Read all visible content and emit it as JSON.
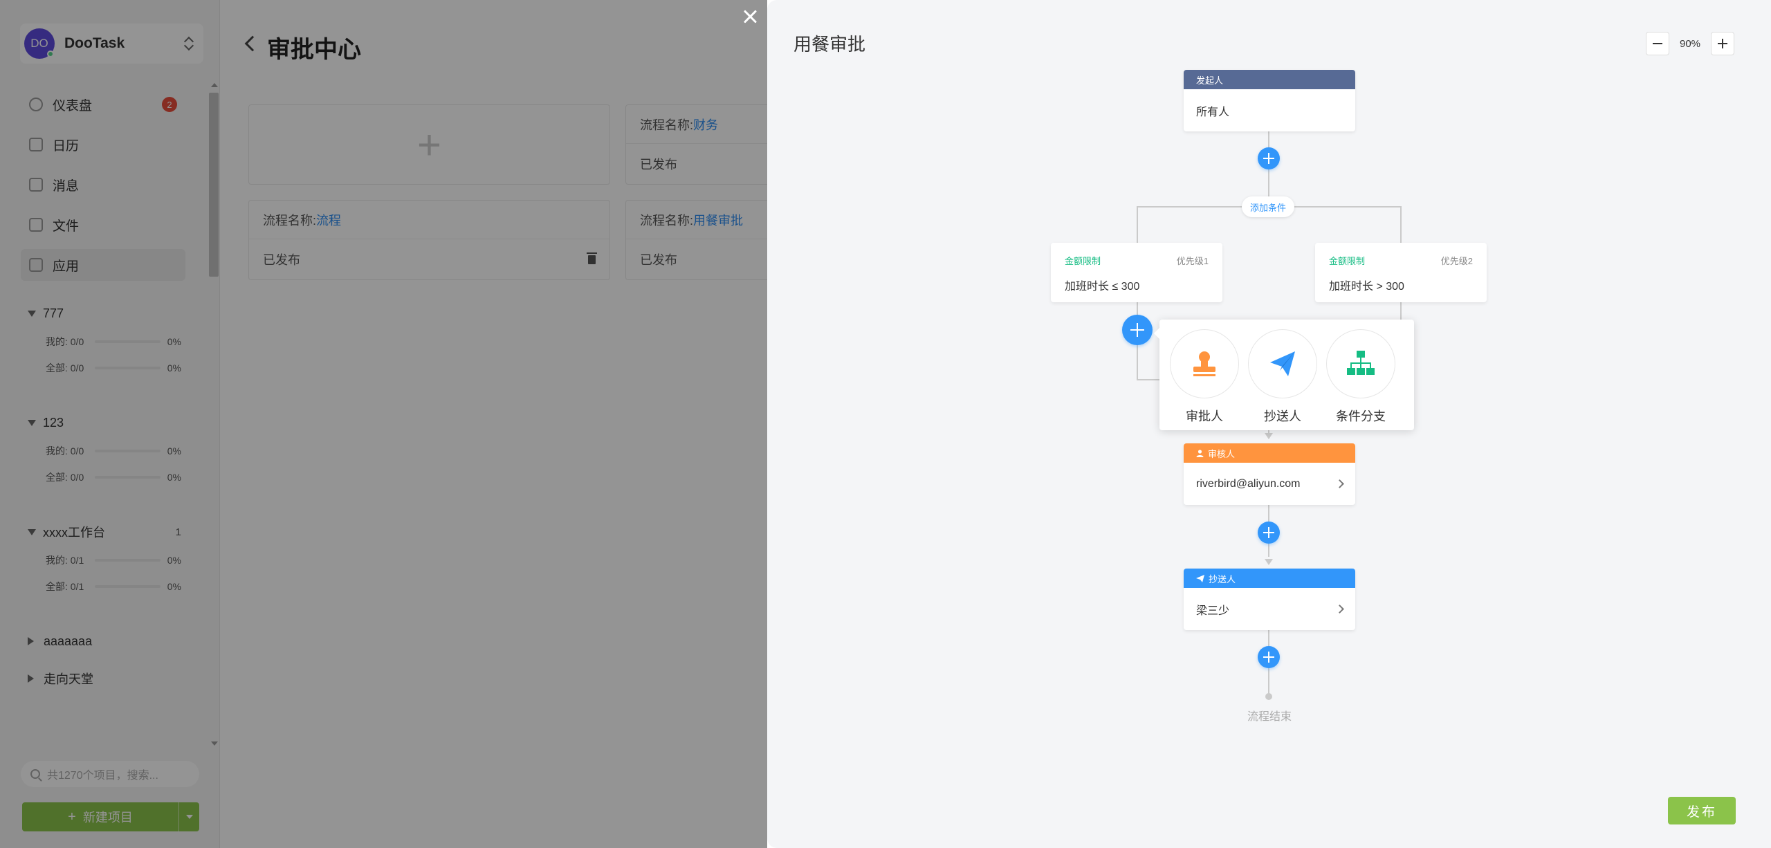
{
  "sidebar": {
    "user": {
      "initials": "DO",
      "name": "DooTask"
    },
    "menu": [
      {
        "label": "仪表盘",
        "badge": "2"
      },
      {
        "label": "日历"
      },
      {
        "label": "消息"
      },
      {
        "label": "文件"
      },
      {
        "label": "应用"
      }
    ],
    "projects": [
      {
        "name": "777",
        "count": "",
        "mine_label": "我的:",
        "mine": "0/0",
        "mine_pct": "0%",
        "all_label": "全部:",
        "all": "0/0",
        "all_pct": "0%"
      },
      {
        "name": "123",
        "count": "",
        "mine_label": "我的:",
        "mine": "0/0",
        "mine_pct": "0%",
        "all_label": "全部:",
        "all": "0/0",
        "all_pct": "0%"
      },
      {
        "name": "xxxx工作台",
        "count": "1",
        "mine_label": "我的:",
        "mine": "0/1",
        "mine_pct": "0%",
        "all_label": "全部:",
        "all": "0/1",
        "all_pct": "0%"
      }
    ],
    "collapsed_projects": [
      "aaaaaaa",
      "走向天堂"
    ],
    "search_placeholder": "共1270个项目，搜索...",
    "new_project": "新建项目"
  },
  "main": {
    "title": "审批中心",
    "cards": [
      {
        "name_label": "流程名称:",
        "name": "财务",
        "status": "已发布"
      },
      {
        "name_label": "流程名称:",
        "name": "流程",
        "status": "已发布"
      },
      {
        "name_label": "流程名称:",
        "name": "用餐审批",
        "status": "已发布"
      }
    ]
  },
  "drawer": {
    "title": "用餐审批",
    "zoom": "90%",
    "initiator": {
      "header": "发起人",
      "value": "所有人"
    },
    "add_condition": "添加条件",
    "conditions": [
      {
        "title": "金额限制",
        "priority": "优先级1",
        "expr": "加班时长 ≤ 300"
      },
      {
        "title": "金额限制",
        "priority": "优先级2",
        "expr": "加班时长 > 300"
      }
    ],
    "popover": [
      {
        "label": "审批人",
        "icon": "stamp-icon",
        "color": "#ff943e"
      },
      {
        "label": "抄送人",
        "icon": "paper-plane-icon",
        "color": "#3296fa"
      },
      {
        "label": "条件分支",
        "icon": "org-chart-icon",
        "color": "#15bc83"
      }
    ],
    "approver": {
      "header": "审核人",
      "value": "riverbird@aliyun.com",
      "color": "#ff943e"
    },
    "cc": {
      "header": "抄送人",
      "value": "梁三少",
      "color": "#3296fa"
    },
    "end": "流程结束",
    "publish": "发布"
  },
  "colors": {
    "initiator_header": "#576a95",
    "accent": "#3296fa",
    "publish": "#8bc34a"
  }
}
